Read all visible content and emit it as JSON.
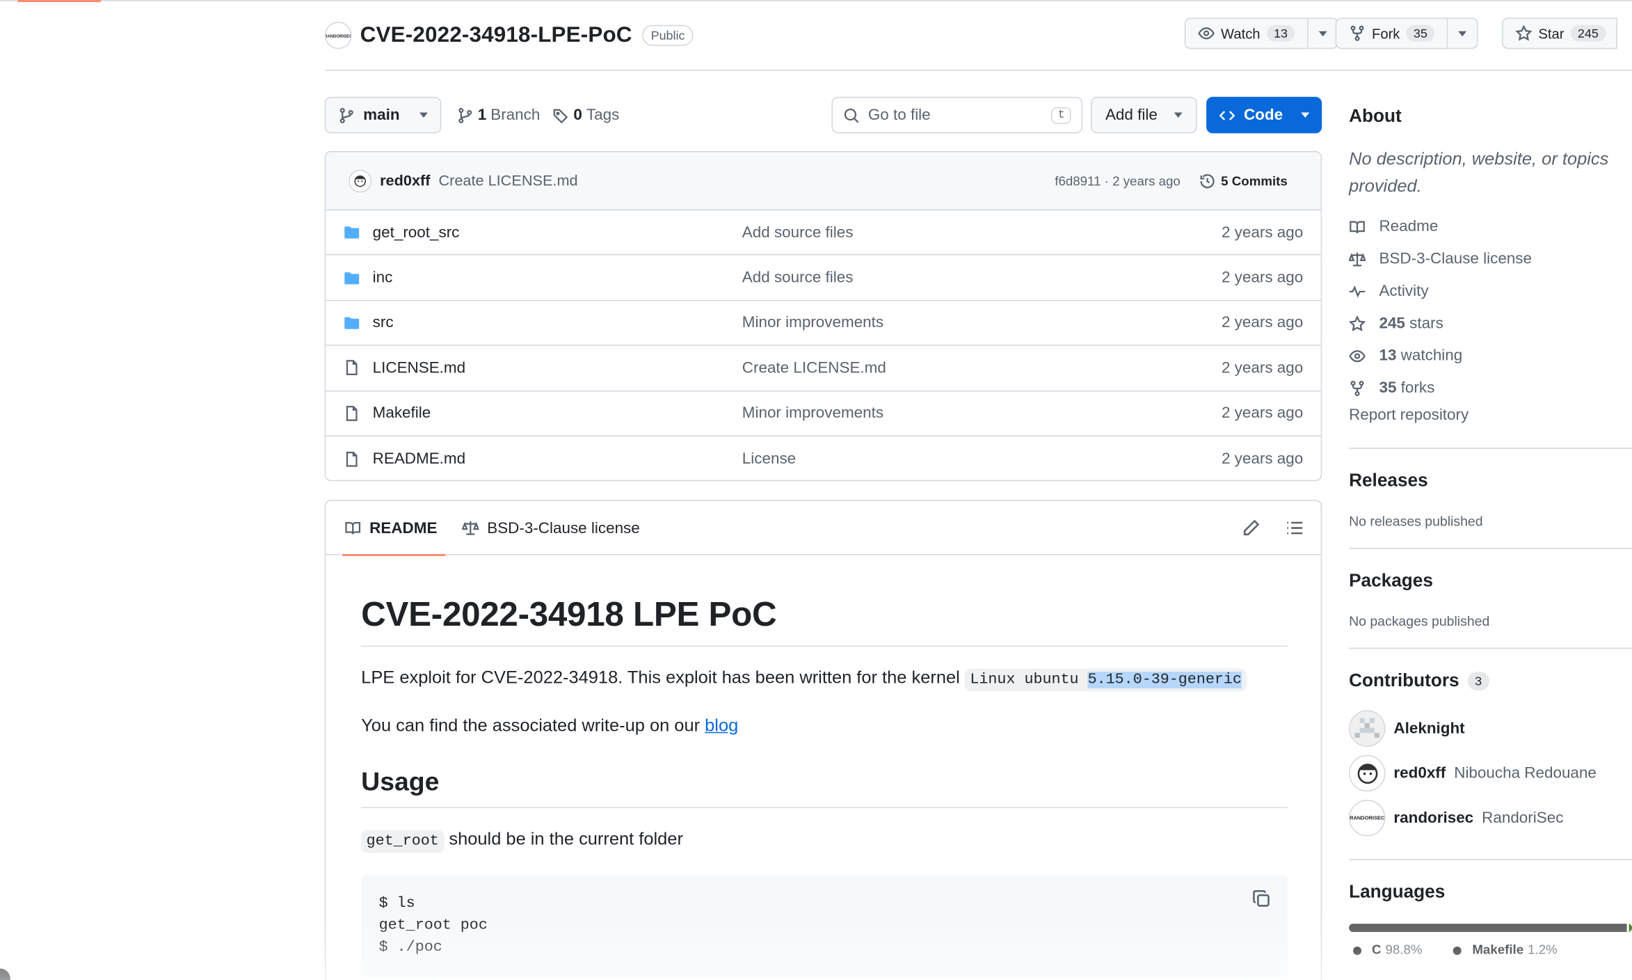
{
  "repo": {
    "owner_logo_text": "RANDORISEC",
    "name": "CVE-2022-34918-LPE-PoC",
    "visibility": "Public"
  },
  "actions": {
    "watch_label": "Watch",
    "watch_count": "13",
    "fork_label": "Fork",
    "fork_count": "35",
    "star_label": "Star",
    "star_count": "245"
  },
  "toolbar": {
    "branch": "main",
    "branches_count": "1",
    "branches_label": "Branch",
    "tags_count": "0",
    "tags_label": "Tags",
    "goto_placeholder": "Go to file",
    "goto_kbd": "t",
    "add_file": "Add file",
    "code": "Code"
  },
  "commit": {
    "author": "red0xff",
    "message": "Create LICENSE.md",
    "meta": "f6d8911 · 2 years ago",
    "commits_label": "5 Commits"
  },
  "files": [
    {
      "type": "dir",
      "name": "get_root_src",
      "message": "Add source files",
      "date": "2 years ago"
    },
    {
      "type": "dir",
      "name": "inc",
      "message": "Add source files",
      "date": "2 years ago"
    },
    {
      "type": "dir",
      "name": "src",
      "message": "Minor improvements",
      "date": "2 years ago"
    },
    {
      "type": "file",
      "name": "LICENSE.md",
      "message": "Create LICENSE.md",
      "date": "2 years ago"
    },
    {
      "type": "file",
      "name": "Makefile",
      "message": "Minor improvements",
      "date": "2 years ago"
    },
    {
      "type": "file",
      "name": "README.md",
      "message": "License",
      "date": "2 years ago"
    }
  ],
  "readme": {
    "tab_readme": "README",
    "tab_license": "BSD-3-Clause license",
    "h1": "CVE-2022-34918 LPE PoC",
    "p1_text": "LPE exploit for CVE-2022-34918. This exploit has been written for the kernel",
    "p1_code_a": "Linux ubuntu ",
    "p1_code_b": "5.15.0-39-generic",
    "p2_text": "You can find the associated write-up on our",
    "p2_link": "blog",
    "h2": "Usage",
    "p3_code": "get_root",
    "p3_text": "should be in the current folder",
    "code_lines": [
      "$ ls",
      "get_root poc",
      "$ ./poc"
    ]
  },
  "sidebar": {
    "about_title": "About",
    "about_desc": "No description, website, or topics provided.",
    "items": [
      {
        "icon": "book-icon",
        "label": "Readme",
        "count": ""
      },
      {
        "icon": "scale-icon",
        "label": "BSD-3-Clause license",
        "count": ""
      },
      {
        "icon": "pulse-icon",
        "label": "Activity",
        "count": ""
      },
      {
        "icon": "star-icon",
        "label": "stars",
        "count": "245"
      },
      {
        "icon": "eye-icon",
        "label": "watching",
        "count": "13"
      },
      {
        "icon": "fork-icon",
        "label": "forks",
        "count": "35"
      }
    ],
    "report": "Report repository",
    "releases_title": "Releases",
    "releases_empty": "No releases published",
    "packages_title": "Packages",
    "packages_empty": "No packages published",
    "contributors_title": "Contributors",
    "contributors_count": "3",
    "contributors": [
      {
        "login": "Aleknight",
        "name": ""
      },
      {
        "login": "red0xff",
        "name": "Niboucha Redouane"
      },
      {
        "login": "randorisec",
        "name": "RandoriSec"
      }
    ],
    "languages_title": "Languages",
    "languages": [
      {
        "name": "C",
        "percent": "98.8%",
        "value": 98.8,
        "color": "#555555"
      },
      {
        "name": "Makefile",
        "percent": "1.2%",
        "value": 1.2,
        "color": "#427819"
      }
    ]
  },
  "colors": {
    "accent": "#0969da",
    "tab_underline": "#fd8c73",
    "folder": "#54aeff",
    "selection": "#b6d7fb"
  }
}
